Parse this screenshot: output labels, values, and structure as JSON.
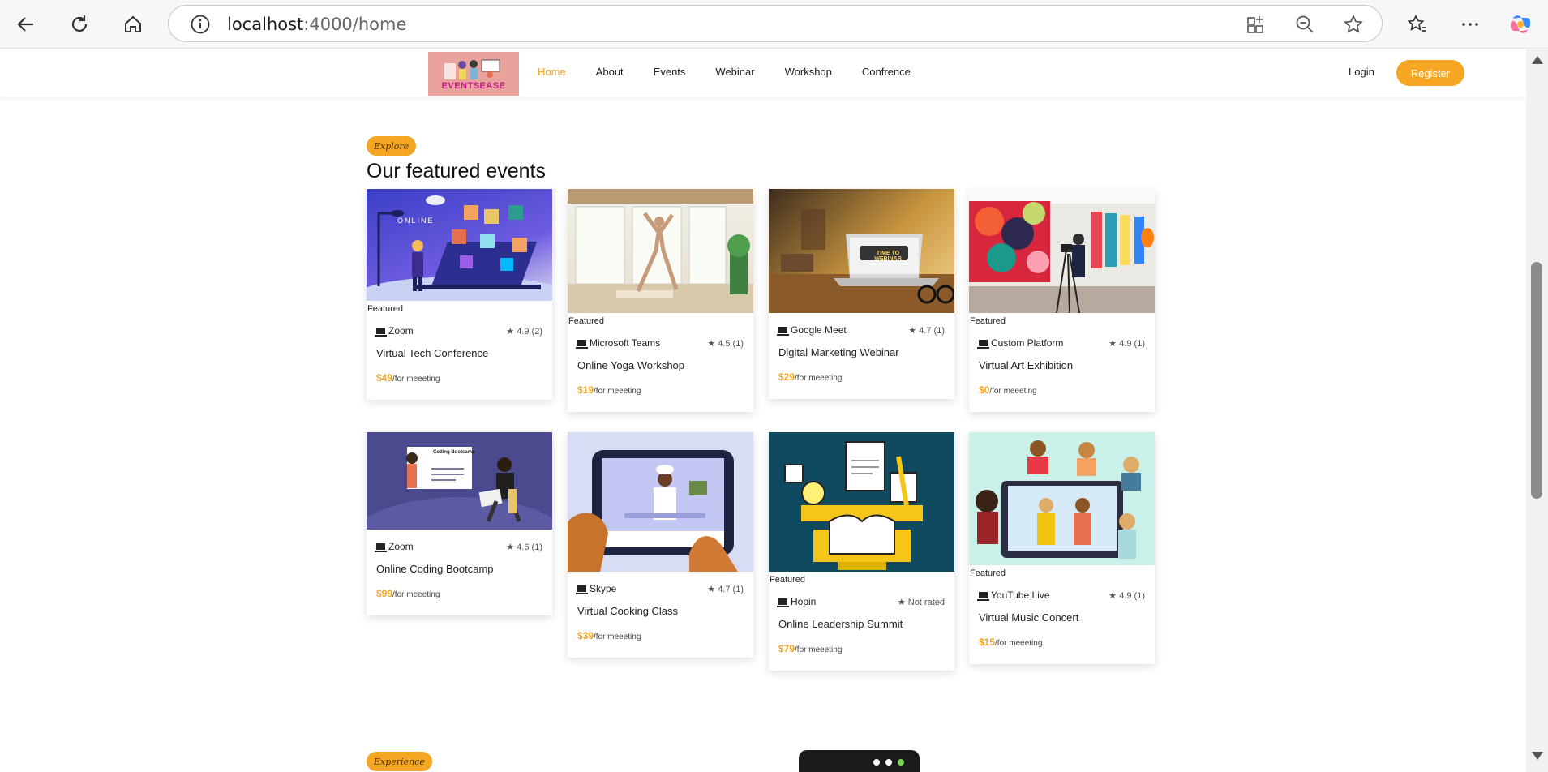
{
  "browser": {
    "url_host": "localhost",
    "url_path": ":4000/home"
  },
  "site": {
    "logo_text": "EVENTSEASE",
    "nav": [
      {
        "label": "Home",
        "active": true
      },
      {
        "label": "About"
      },
      {
        "label": "Events"
      },
      {
        "label": "Webinar"
      },
      {
        "label": "Workshop"
      },
      {
        "label": "Confrence"
      }
    ],
    "login_label": "Login",
    "register_label": "Register",
    "accent_color": "#f5a623"
  },
  "featured": {
    "badge": "Explore",
    "title": "Our featured events",
    "featured_label": "Featured",
    "per_label": "/for meeeting",
    "events": [
      {
        "title": "Virtual Tech Conference",
        "platform": "Zoom",
        "rating": "4.9 (2)",
        "price": "$49",
        "featured": true
      },
      {
        "title": "Online Yoga Workshop",
        "platform": "Microsoft Teams",
        "rating": "4.5 (1)",
        "price": "$19",
        "featured": true
      },
      {
        "title": "Digital Marketing Webinar",
        "platform": "Google Meet",
        "rating": "4.7 (1)",
        "price": "$29",
        "featured": false
      },
      {
        "title": "Virtual Art Exhibition",
        "platform": "Custom Platform",
        "rating": "4.9 (1)",
        "price": "$0",
        "featured": true
      },
      {
        "title": "Online Coding Bootcamp",
        "platform": "Zoom",
        "rating": "4.6 (1)",
        "price": "$99",
        "featured": false
      },
      {
        "title": "Virtual Cooking Class",
        "platform": "Skype",
        "rating": "4.7 (1)",
        "price": "$39",
        "featured": false
      },
      {
        "title": "Online Leadership Summit",
        "platform": "Hopin",
        "rating": "Not rated",
        "price": "$79",
        "featured": true
      },
      {
        "title": "Virtual Music Concert",
        "platform": "YouTube Live",
        "rating": "4.9 (1)",
        "price": "$15",
        "featured": true
      }
    ],
    "image_texts": {
      "conference": "ONLINE",
      "webinar": "TIME TO WEBINAR",
      "bootcamp": "Coding Bootcamp"
    }
  },
  "next_section": {
    "badge": "Experience"
  }
}
